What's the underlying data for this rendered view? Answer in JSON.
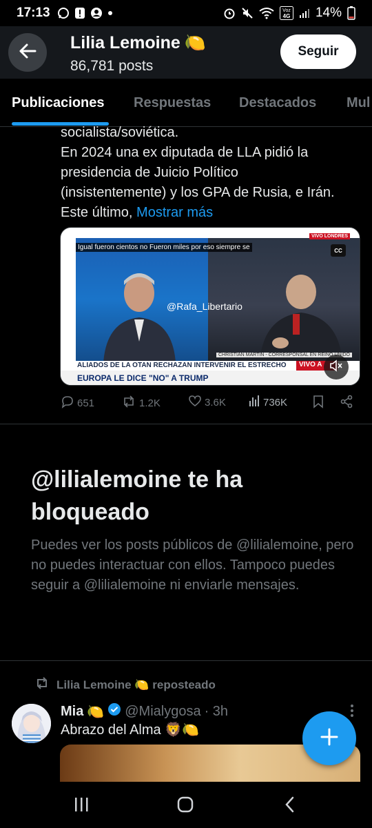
{
  "status_bar": {
    "time": "17:13",
    "battery": "14%",
    "network_label": "Voz 4G"
  },
  "header": {
    "title": "Lilia Lemoine",
    "title_emoji": "🍋",
    "posts_count": "86,781 posts",
    "follow_label": "Seguir"
  },
  "tabs": [
    {
      "label": "Publicaciones",
      "active": true
    },
    {
      "label": "Respuestas",
      "active": false
    },
    {
      "label": "Destacados",
      "active": false
    },
    {
      "label": "Mul",
      "active": false
    }
  ],
  "tweet": {
    "lines": [
      "socialista/soviética.",
      "En 2024 una ex diputada de LLA pidió la",
      "presidencia de Juicio Político",
      "(insistentemente) y los GPA de Rusia, e Irán.",
      "Este último, "
    ],
    "show_more": "Mostrar más",
    "video": {
      "caption": "Igual fueron cientos no Fueron miles por eso siempre se",
      "watermark": "@Rafa_Libertario",
      "cc": "CC",
      "live_tag": "VIVO LONDRES",
      "reporter": "CHRISTIAN MARTIN - CORRESPONSAL EN REINO UNIDO",
      "ticker_top": "ALIADOS DE LA OTAN RECHAZAN INTERVENIR EL ESTRECHO",
      "ticker_live": "VIVO A",
      "ticker_bottom": "EUROPA LE DICE \"NO\" A TRUMP"
    },
    "replies": "651",
    "reposts": "1.2K",
    "likes": "3.6K",
    "views": "736K"
  },
  "blocked": {
    "title": "@lilialemoine te ha bloqueado",
    "description": "Puedes ver los posts públicos de @lilialemoine, pero no puedes interactuar con ellos. Tampoco puedes seguir a @lilialemoine ni enviarle mensajes."
  },
  "repost": {
    "reposter": "Lilia Lemoine 🍋 reposteado",
    "author_name": "Mia",
    "author_emoji": "🍋",
    "handle": "@Mialygosa",
    "time": "· 3h",
    "text": "Abrazo del Alma 🦁🍋"
  },
  "colors": {
    "accent": "#1d9bf0",
    "background": "#000000",
    "muted_text": "#71767b"
  }
}
